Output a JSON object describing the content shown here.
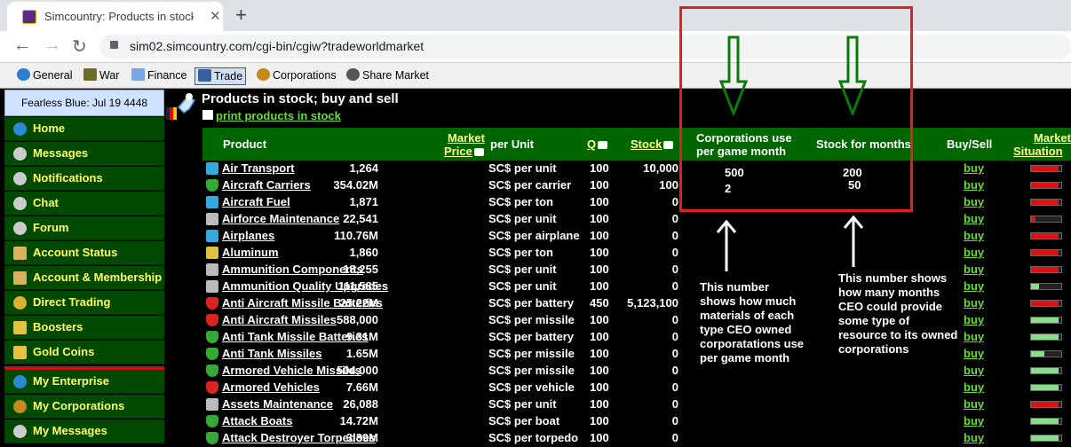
{
  "browser": {
    "tab_title": "Simcountry: Products in stock; bu",
    "url": "sim02.simcountry.com/cgi-bin/cgiw?tradeworldmarket"
  },
  "menubar": [
    {
      "label": "General",
      "icon": "globe-icon"
    },
    {
      "label": "War",
      "icon": "tank-icon"
    },
    {
      "label": "Finance",
      "icon": "chart-icon"
    },
    {
      "label": "Trade",
      "icon": "scale-icon",
      "active": true
    },
    {
      "label": "Corporations",
      "icon": "gear-icon"
    },
    {
      "label": "Share Market",
      "icon": "shares-icon"
    }
  ],
  "sidebar": {
    "date": "Fearless Blue: Jul 19 4448",
    "items": [
      {
        "label": "Home",
        "icon": "globe-icon"
      },
      {
        "label": "Messages",
        "icon": "antenna-icon"
      },
      {
        "label": "Notifications",
        "icon": "antenna-icon"
      },
      {
        "label": "Chat",
        "icon": "antenna-icon"
      },
      {
        "label": "Forum",
        "icon": "antenna-icon"
      },
      {
        "label": "Account Status",
        "icon": "building-icon"
      },
      {
        "label": "Account & Membership",
        "icon": "building-icon"
      },
      {
        "label": "Direct Trading",
        "icon": "coins-icon"
      },
      {
        "label": "Boosters",
        "icon": "gold-bar-icon"
      },
      {
        "label": "Gold Coins",
        "icon": "gold-bar-icon"
      },
      {
        "label": "My Enterprise",
        "icon": "globe-icon"
      },
      {
        "label": "My Corporations",
        "icon": "gear-icon"
      },
      {
        "label": "My Messages",
        "icon": "antenna-icon"
      }
    ]
  },
  "page": {
    "title": "Products in stock; buy and sell",
    "print_link": "print products in stock"
  },
  "table": {
    "headers": {
      "product": "Product",
      "market_price_1": "Market",
      "market_price_2": "Price",
      "per_unit": "per Unit",
      "q": "Q",
      "stock": "Stock",
      "corp_use_1": "Corporations use",
      "corp_use_2": "per game month",
      "stock_months": "Stock for months",
      "buysell": "Buy/Sell",
      "market_sit_1": "Market",
      "market_sit_2": "Situation"
    },
    "buy_label": "buy",
    "rows": [
      {
        "name": "Air Transport",
        "price": "1,264",
        "unit": "SC$ per unit",
        "q": "100",
        "stock": "10,000",
        "corp_use": "500",
        "months": "200",
        "icon": "flask-icon",
        "situation": 0.9,
        "sit_color": "#dd1111"
      },
      {
        "name": "Aircraft Carriers",
        "price": "354.02M",
        "unit": "SC$ per carrier",
        "q": "100",
        "stock": "100",
        "corp_use": "2",
        "months": "50",
        "icon": "shield-icon",
        "situation": 0.9,
        "sit_color": "#dd1111"
      },
      {
        "name": "Aircraft Fuel",
        "price": "1,871",
        "unit": "SC$ per ton",
        "q": "100",
        "stock": "0",
        "corp_use": "",
        "months": "",
        "icon": "flask-icon",
        "situation": 0.9,
        "sit_color": "#dd1111"
      },
      {
        "name": "Airforce Maintenance",
        "price": "22,541",
        "unit": "SC$ per unit",
        "q": "100",
        "stock": "0",
        "corp_use": "",
        "months": "",
        "icon": "wrench-icon",
        "situation": 0.15,
        "sit_color": "#dd1111"
      },
      {
        "name": "Airplanes",
        "price": "110.76M",
        "unit": "SC$ per airplane",
        "q": "100",
        "stock": "0",
        "corp_use": "",
        "months": "",
        "icon": "flask-icon",
        "situation": 0.9,
        "sit_color": "#dd1111"
      },
      {
        "name": "Aluminum",
        "price": "1,860",
        "unit": "SC$ per ton",
        "q": "100",
        "stock": "0",
        "corp_use": "",
        "months": "",
        "icon": "pickaxe-icon",
        "situation": 0.9,
        "sit_color": "#dd1111"
      },
      {
        "name": "Ammunition Components",
        "price": "18,255",
        "unit": "SC$ per unit",
        "q": "100",
        "stock": "0",
        "corp_use": "",
        "months": "",
        "icon": "wrench-icon",
        "situation": 0.9,
        "sit_color": "#dd1111"
      },
      {
        "name": "Ammunition Quality Upgrades",
        "price": "111,585",
        "unit": "SC$ per unit",
        "q": "100",
        "stock": "0",
        "corp_use": "",
        "months": "",
        "icon": "wrench-icon",
        "situation": 0.25,
        "sit_color": "#88dd88"
      },
      {
        "name": "Anti Aircraft Missile Batteries",
        "price": "25.22M",
        "unit": "SC$ per battery",
        "q": "450",
        "stock": "5,123,100",
        "corp_use": "",
        "months": "",
        "icon": "shield-red-icon",
        "situation": 0.9,
        "sit_color": "#dd1111"
      },
      {
        "name": "Anti Aircraft Missiles",
        "price": "588,000",
        "unit": "SC$ per missile",
        "q": "100",
        "stock": "0",
        "corp_use": "",
        "months": "",
        "icon": "shield-red-icon",
        "situation": 0.9,
        "sit_color": "#88dd88"
      },
      {
        "name": "Anti Tank Missile Batteries",
        "price": "9.31M",
        "unit": "SC$ per battery",
        "q": "100",
        "stock": "0",
        "corp_use": "",
        "months": "",
        "icon": "shield-icon",
        "situation": 0.9,
        "sit_color": "#88dd88"
      },
      {
        "name": "Anti Tank Missiles",
        "price": "1.65M",
        "unit": "SC$ per missile",
        "q": "100",
        "stock": "0",
        "corp_use": "",
        "months": "",
        "icon": "shield-icon",
        "situation": 0.45,
        "sit_color": "#88dd88"
      },
      {
        "name": "Armored Vehicle Missiles",
        "price": "504,000",
        "unit": "SC$ per missile",
        "q": "100",
        "stock": "0",
        "corp_use": "",
        "months": "",
        "icon": "shield-icon",
        "situation": 0.9,
        "sit_color": "#88dd88"
      },
      {
        "name": "Armored Vehicles",
        "price": "7.66M",
        "unit": "SC$ per vehicle",
        "q": "100",
        "stock": "0",
        "corp_use": "",
        "months": "",
        "icon": "shield-red-icon",
        "situation": 0.9,
        "sit_color": "#88dd88"
      },
      {
        "name": "Assets Maintenance",
        "price": "26,088",
        "unit": "SC$ per unit",
        "q": "100",
        "stock": "0",
        "corp_use": "",
        "months": "",
        "icon": "wrench-icon",
        "situation": 0.9,
        "sit_color": "#dd1111"
      },
      {
        "name": "Attack Boats",
        "price": "14.72M",
        "unit": "SC$ per boat",
        "q": "100",
        "stock": "0",
        "corp_use": "",
        "months": "",
        "icon": "shield-icon",
        "situation": 0.9,
        "sit_color": "#88dd88"
      },
      {
        "name": "Attack Destroyer Torpedoes",
        "price": "3.39M",
        "unit": "SC$ per torpedo",
        "q": "100",
        "stock": "0",
        "corp_use": "",
        "months": "",
        "icon": "shield-icon",
        "situation": 0.9,
        "sit_color": "#88dd88"
      }
    ]
  },
  "annotations": {
    "left_text": [
      "This number",
      "shows how much",
      "materials of each",
      "type CEO owned",
      "corporatations use",
      "per game month"
    ],
    "right_text": [
      "This number shows",
      "how many months",
      "CEO could provide",
      "some type of",
      "resource to its owned",
      "corporations"
    ]
  }
}
